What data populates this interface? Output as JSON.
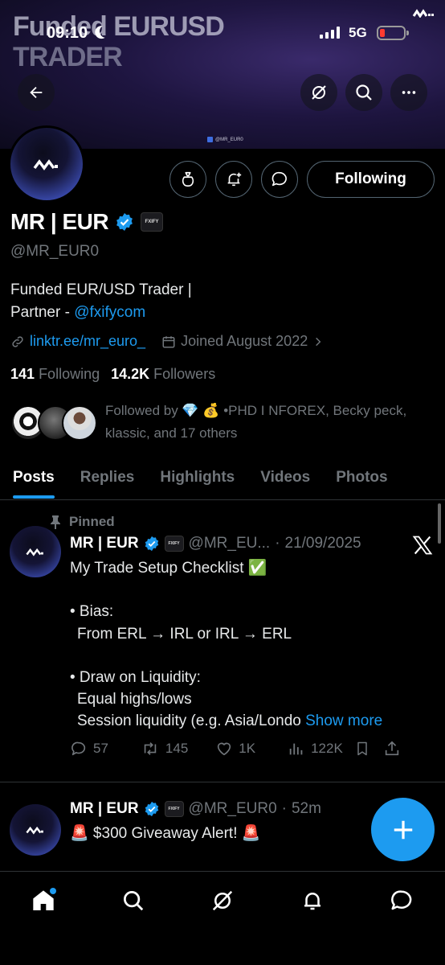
{
  "status_bar": {
    "time": "09:10",
    "network": "5G"
  },
  "banner": {
    "title_line1": "Funded EURUSD",
    "title_line2": "TRADER",
    "tag": "@MR_EUR0"
  },
  "profile": {
    "name": "MR | EUR",
    "badge": "FXIFY",
    "handle": "@MR_EUR0",
    "bio_line1": "Funded EUR/USD Trader |",
    "bio_line2_prefix": "Partner - ",
    "bio_mention": "@fxifycom",
    "link": "linktr.ee/mr_euro_",
    "joined": "Joined August 2022",
    "following_count": "141",
    "following_label": "Following",
    "followers_count": "14.2K",
    "followers_label": "Followers",
    "followed_by": "Followed by 💎 💰 •PHD I NFOREX, Becky peck, klassic, and 17 others",
    "following_button": "Following"
  },
  "tabs": [
    {
      "label": "Posts",
      "active": true
    },
    {
      "label": "Replies"
    },
    {
      "label": "Highlights"
    },
    {
      "label": "Videos"
    },
    {
      "label": "Photos"
    }
  ],
  "posts": [
    {
      "pinned_label": "Pinned",
      "name": "MR | EUR",
      "badge": "FXIFY",
      "handle": "@MR_EU...",
      "sep": "·",
      "date": "21/09/2025",
      "lines": [
        "My Trade Setup Checklist ✅",
        "",
        "• Bias:",
        "  From ERL → IRL or IRL → ERL",
        "",
        "• Draw on Liquidity:",
        "  Equal highs/lows",
        "  Session liquidity (e.g. Asia/Londo"
      ],
      "show_more": "Show more",
      "replies": "57",
      "reposts": "145",
      "likes": "1K",
      "views": "122K"
    },
    {
      "name": "MR | EUR",
      "badge": "FXIFY",
      "handle": "@MR_EUR0",
      "sep": "·",
      "date": "52m",
      "text": "🚨 $300 Giveaway Alert! 🚨"
    }
  ],
  "colors": {
    "accent": "#1d9bf0",
    "muted": "#71767b",
    "background": "#000000"
  },
  "icons": [
    "back-arrow-icon",
    "grok-icon",
    "search-icon",
    "more-icon",
    "money-bag-icon",
    "notify-plus-icon",
    "message-icon",
    "verified-icon",
    "link-icon",
    "calendar-icon",
    "chevron-right-icon",
    "pin-icon",
    "x-logo-icon",
    "reply-icon",
    "repost-icon",
    "like-icon",
    "views-icon",
    "bookmark-icon",
    "share-icon",
    "compose-plus-icon",
    "home-icon",
    "explore-icon",
    "notifications-icon",
    "messages-icon"
  ]
}
